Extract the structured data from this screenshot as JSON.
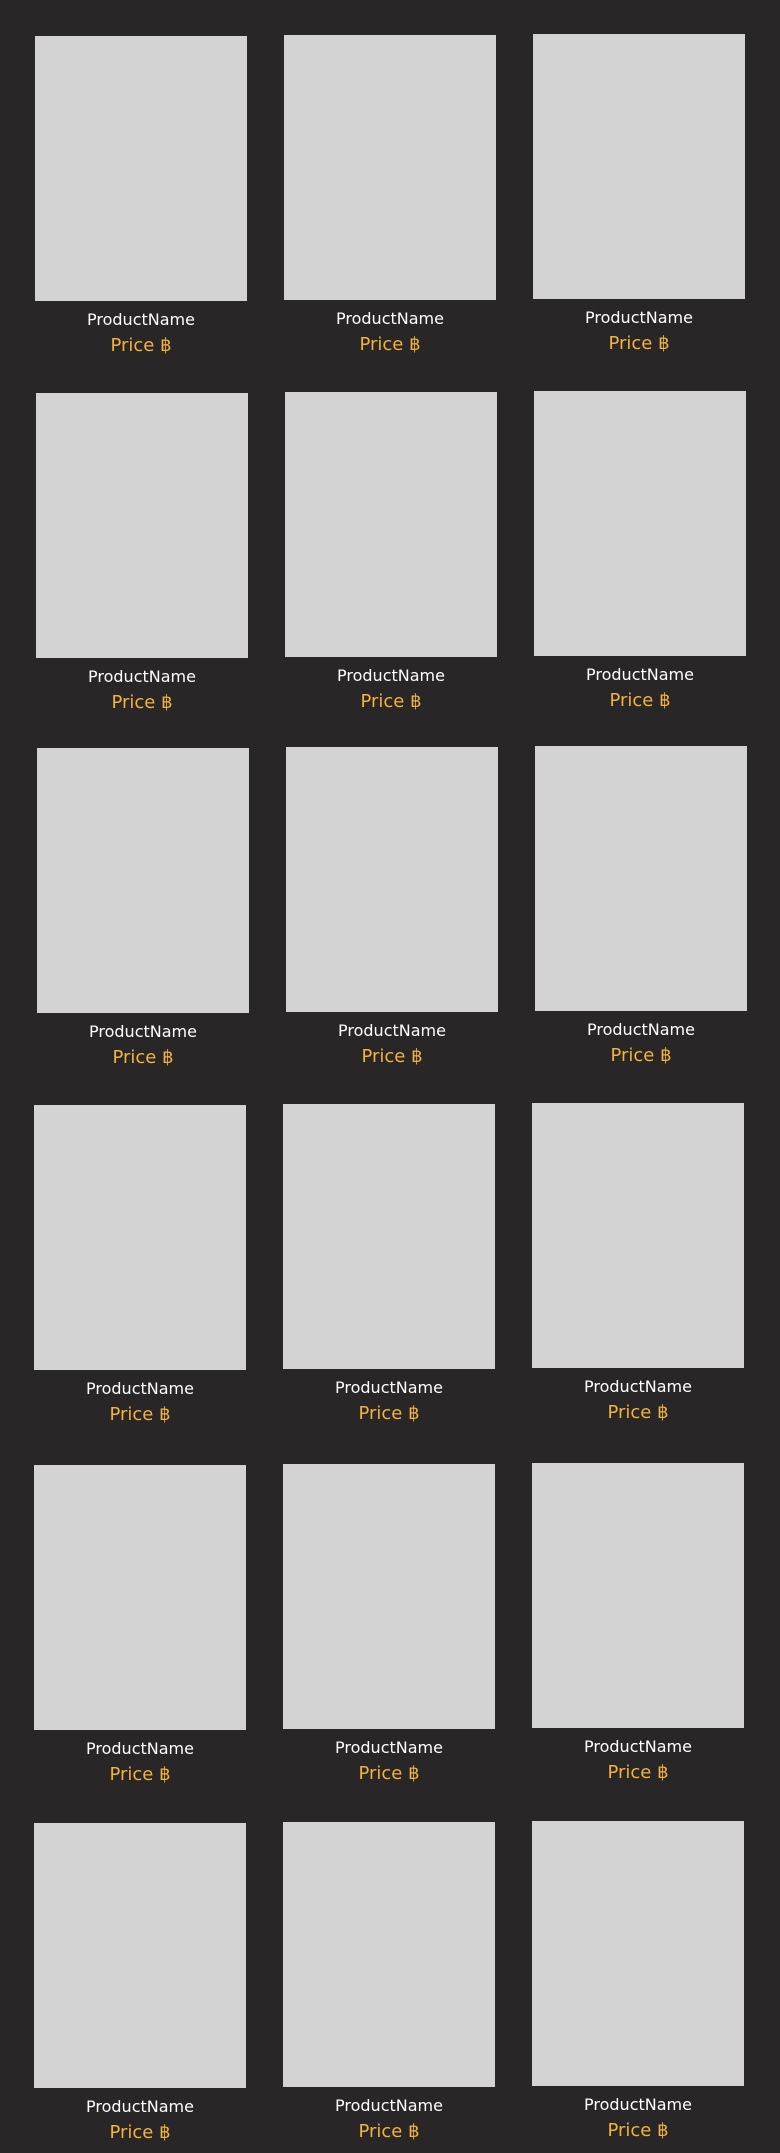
{
  "colors": {
    "background": "#282627",
    "thumbnail": "#d3d3d3",
    "name_text": "#ffffff",
    "price_text": "#f3b23c"
  },
  "products": [
    {
      "name": "ProductName",
      "price": "Price ฿"
    },
    {
      "name": "ProductName",
      "price": "Price ฿"
    },
    {
      "name": "ProductName",
      "price": "Price ฿"
    },
    {
      "name": "ProductName",
      "price": "Price ฿"
    },
    {
      "name": "ProductName",
      "price": "Price ฿"
    },
    {
      "name": "ProductName",
      "price": "Price ฿"
    },
    {
      "name": "ProductName",
      "price": "Price ฿"
    },
    {
      "name": "ProductName",
      "price": "Price ฿"
    },
    {
      "name": "ProductName",
      "price": "Price ฿"
    },
    {
      "name": "ProductName",
      "price": "Price ฿"
    },
    {
      "name": "ProductName",
      "price": "Price ฿"
    },
    {
      "name": "ProductName",
      "price": "Price ฿"
    },
    {
      "name": "ProductName",
      "price": "Price ฿"
    },
    {
      "name": "ProductName",
      "price": "Price ฿"
    },
    {
      "name": "ProductName",
      "price": "Price ฿"
    },
    {
      "name": "ProductName",
      "price": "Price ฿"
    },
    {
      "name": "ProductName",
      "price": "Price ฿"
    },
    {
      "name": "ProductName",
      "price": "Price ฿"
    }
  ]
}
